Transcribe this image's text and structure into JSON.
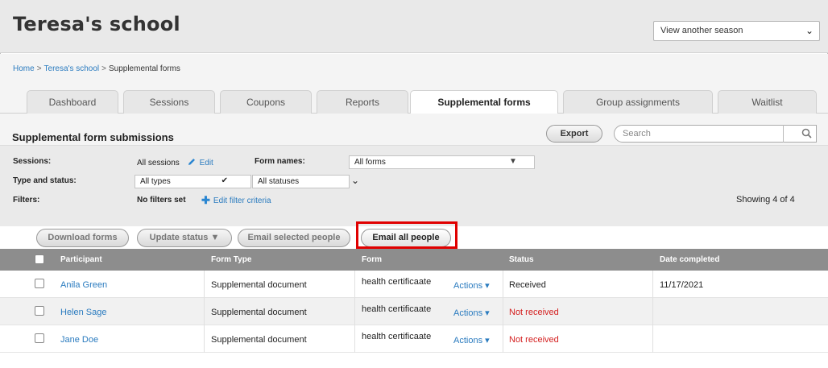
{
  "header": {
    "title": "Teresa's school",
    "season_select": "View another season"
  },
  "breadcrumb": {
    "home": "Home",
    "school": "Teresa's school",
    "current": "Supplemental forms",
    "separator": ">"
  },
  "tabs": [
    {
      "label": "Dashboard",
      "active": false
    },
    {
      "label": "Sessions",
      "active": false
    },
    {
      "label": "Coupons",
      "active": false
    },
    {
      "label": "Reports",
      "active": false
    },
    {
      "label": "Supplemental forms",
      "active": true
    },
    {
      "label": "Group assignments",
      "active": false
    },
    {
      "label": "Waitlist",
      "active": false
    }
  ],
  "panel": {
    "title": "Supplemental form submissions",
    "export_label": "Export",
    "search_placeholder": "Search"
  },
  "filters": {
    "sessions_label": "Sessions:",
    "sessions_value": "All sessions",
    "edit_label": "Edit",
    "form_names_label": "Form names:",
    "form_names_value": "All forms",
    "type_status_label": "Type and status:",
    "type_value": "All types",
    "status_value": "All statuses",
    "filters_label": "Filters:",
    "no_filters": "No filters set",
    "edit_filter_criteria": "Edit filter criteria",
    "showing": "Showing 4 of 4"
  },
  "actions": {
    "download_forms": "Download forms",
    "update_status": "Update status",
    "email_selected": "Email selected people",
    "email_all": "Email all people"
  },
  "table": {
    "headers": [
      "Participant",
      "Form Type",
      "Form",
      "Status",
      "Date completed"
    ],
    "rows": [
      {
        "participant": "Anila Green",
        "form_type": "Supplemental document",
        "form": "health certificaate",
        "actions": "Actions",
        "status": "Received",
        "date": "11/17/2021",
        "status_color": "#222222"
      },
      {
        "participant": "Helen Sage",
        "form_type": "Supplemental document",
        "form": "health certificaate",
        "actions": "Actions",
        "status": "Not received",
        "date": "",
        "status_color": "#d42020"
      },
      {
        "participant": "Jane Doe",
        "form_type": "Supplemental document",
        "form": "health certificaate",
        "actions": "Actions",
        "status": "Not received",
        "date": "",
        "status_color": "#d42020"
      }
    ]
  },
  "colors": {
    "link": "#2a7bbf",
    "highlight": "#e00000",
    "header_bar": "#8d8d8d"
  }
}
